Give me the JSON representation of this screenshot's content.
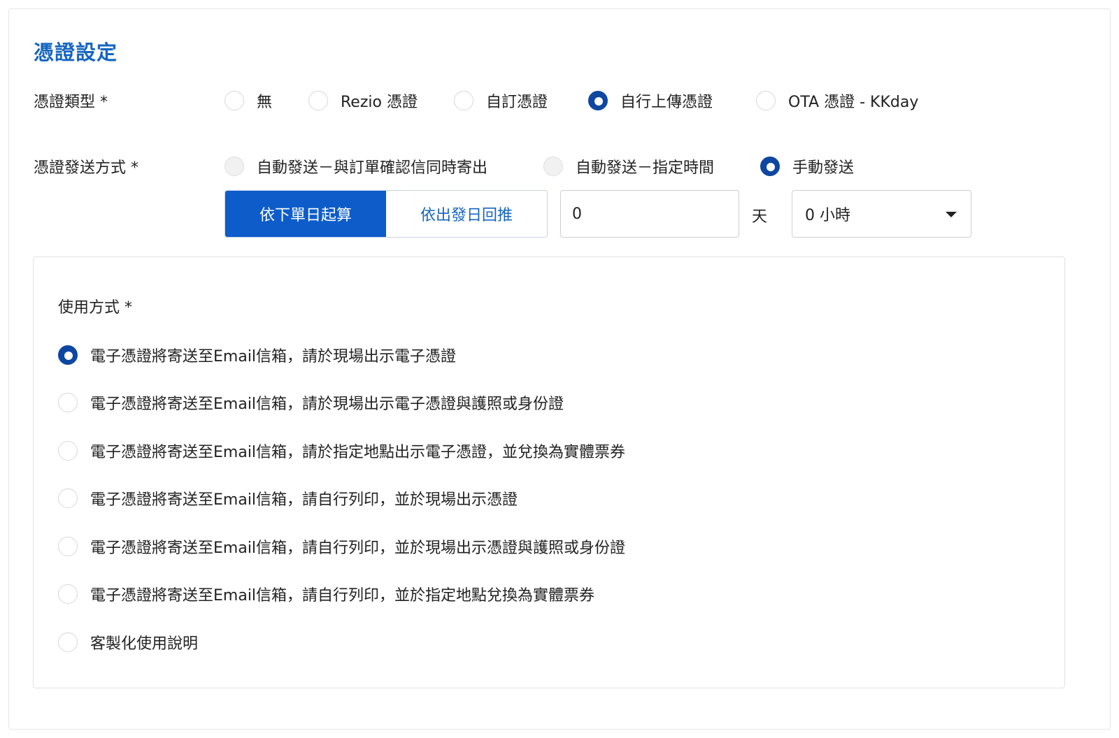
{
  "section": {
    "title": "憑證設定"
  },
  "voucher_type": {
    "label": "憑證類型 *",
    "options": [
      {
        "label": "無",
        "checked": false
      },
      {
        "label": "Rezio 憑證",
        "checked": false
      },
      {
        "label": "自訂憑證",
        "checked": false
      },
      {
        "label": "自行上傳憑證",
        "checked": true
      },
      {
        "label": "OTA 憑證 - KKday",
        "checked": false
      }
    ]
  },
  "send_method": {
    "label": "憑證發送方式 *",
    "options": [
      {
        "label": "自動發送－與訂單確認信同時寄出",
        "checked": false,
        "disabled": true
      },
      {
        "label": "自動發送－指定時間",
        "checked": false,
        "disabled": true
      },
      {
        "label": "手動發送",
        "checked": true,
        "disabled": false
      }
    ],
    "segmented": {
      "active_label": "依下單日起算",
      "inactive_label": "依出發日回推"
    },
    "days_value": "0",
    "days_unit": "天",
    "hours_selected": "0 小時"
  },
  "usage": {
    "label": "使用方式 *",
    "options": [
      {
        "label": "電子憑證將寄送至Email信箱，請於現場出示電子憑證",
        "checked": true
      },
      {
        "label": "電子憑證將寄送至Email信箱，請於現場出示電子憑證與護照或身份證",
        "checked": false
      },
      {
        "label": "電子憑證將寄送至Email信箱，請於指定地點出示電子憑證，並兌換為實體票券",
        "checked": false
      },
      {
        "label": "電子憑證將寄送至Email信箱，請自行列印，並於現場出示憑證",
        "checked": false
      },
      {
        "label": "電子憑證將寄送至Email信箱，請自行列印，並於現場出示憑證與護照或身份證",
        "checked": false
      },
      {
        "label": "電子憑證將寄送至Email信箱，請自行列印，並於指定地點兌換為實體票券",
        "checked": false
      },
      {
        "label": "客製化使用說明",
        "checked": false
      }
    ]
  },
  "colors": {
    "accent": "#0d47a1",
    "title_blue": "#1565c0",
    "segment_active": "#0d5cc9"
  }
}
